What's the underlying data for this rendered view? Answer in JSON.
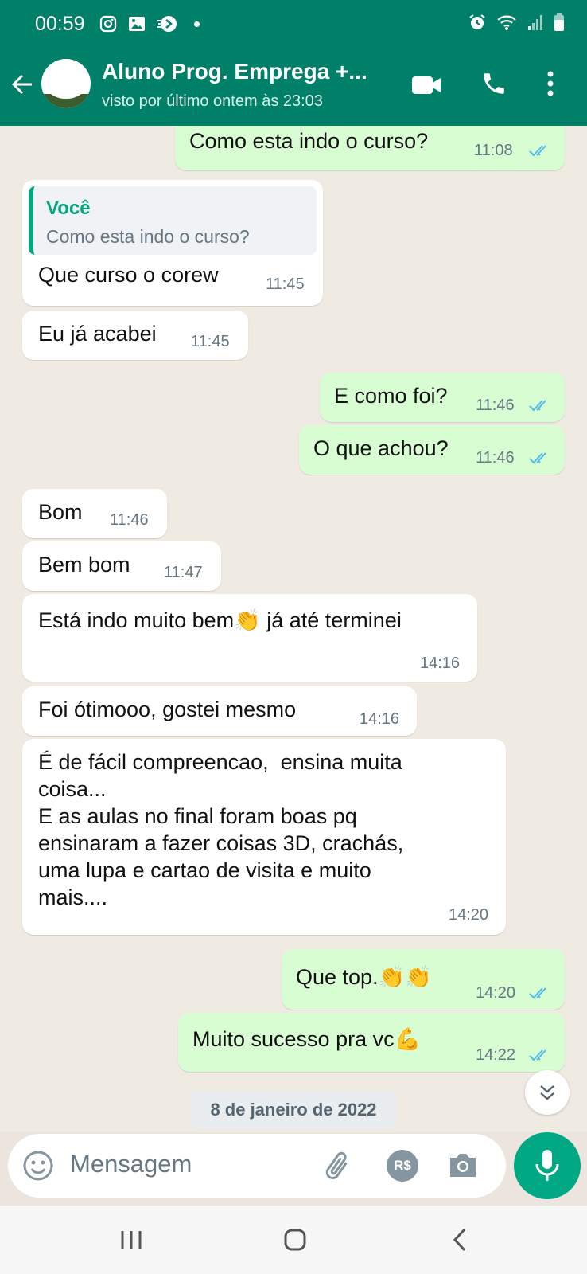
{
  "status_bar": {
    "time": "00:59"
  },
  "header": {
    "contact_name": "Aluno Prog. Emprega +...",
    "last_seen": "visto por último ontem às 23:03"
  },
  "messages": [
    {
      "dir": "out",
      "text": "Como esta indo o curso?",
      "time": "11:08",
      "read": true
    },
    {
      "dir": "in",
      "quote_author": "Você",
      "quote_text": "Como esta indo o curso?",
      "text": "Que curso o corew",
      "time": "11:45"
    },
    {
      "dir": "in",
      "text": "Eu já acabei",
      "time": "11:45"
    },
    {
      "dir": "out",
      "text": "E como foi?",
      "time": "11:46",
      "read": true
    },
    {
      "dir": "out",
      "text": "O que achou?",
      "time": "11:46",
      "read": true
    },
    {
      "dir": "in",
      "text": "Bom",
      "time": "11:46"
    },
    {
      "dir": "in",
      "text": "Bem bom",
      "time": "11:47"
    },
    {
      "dir": "in",
      "text": "Está indo muito bem👏 já até terminei",
      "time": "14:16"
    },
    {
      "dir": "in",
      "text": "Foi ótimooo, gostei mesmo",
      "time": "14:16"
    },
    {
      "dir": "in",
      "text": "É de fácil compreencao,  ensina muita\ncoisa...\nE as aulas no final foram boas pq\nensinaram a fazer coisas 3D, crachás,\numa lupa e cartao de visita e muito\nmais....",
      "time": "14:20"
    },
    {
      "dir": "out",
      "text": "Que top.👏👏",
      "time": "14:20",
      "read": true
    },
    {
      "dir": "out",
      "text": "Muito sucesso pra vc💪",
      "time": "14:22",
      "read": true
    }
  ],
  "date_separator": "8 de janeiro de 2022",
  "composer": {
    "placeholder": "Mensagem",
    "pix_label": "R$"
  },
  "colors": {
    "header": "#008069",
    "outgoing": "#d9fdd3",
    "incoming": "#ffffff",
    "accent": "#00a884",
    "read_ticks": "#53bdeb"
  }
}
